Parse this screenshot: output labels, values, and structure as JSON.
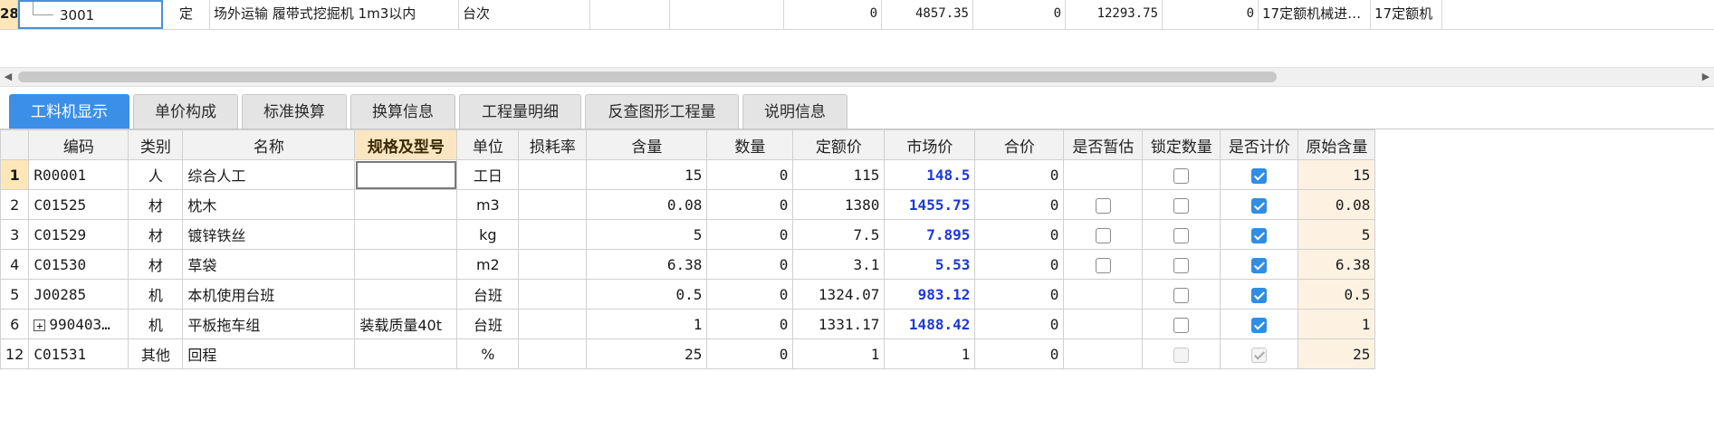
{
  "top_row": {
    "row_number": "28",
    "code": "3001",
    "type": "定",
    "name": "场外运输 履带式挖掘机 1m3以内",
    "unit": "台次",
    "c1": "0",
    "c2": "4857.35",
    "c3": "0",
    "c4": "12293.75",
    "c5": "0",
    "c6": "17定额机械进…",
    "c7": "17定额机"
  },
  "scrollbar": {
    "left_arrow": "◀",
    "right_arrow": "▶"
  },
  "tabs": [
    {
      "label": "工料机显示",
      "active": true
    },
    {
      "label": "单价构成"
    },
    {
      "label": "标准换算"
    },
    {
      "label": "换算信息"
    },
    {
      "label": "工程量明细"
    },
    {
      "label": "反查图形工程量"
    },
    {
      "label": "说明信息"
    }
  ],
  "columns": [
    "编码",
    "类别",
    "名称",
    "规格及型号",
    "单位",
    "损耗率",
    "含量",
    "数量",
    "定额价",
    "市场价",
    "合价",
    "是否暂估",
    "锁定数量",
    "是否计价",
    "原始含量"
  ],
  "rows": [
    {
      "rn": "1",
      "code": "R00001",
      "cat": "人",
      "name": "综合人工",
      "spec": "",
      "unit": "工日",
      "loss": "",
      "qty": "15",
      "num": "0",
      "price": "115",
      "market": "148.5",
      "total": "0",
      "est": null,
      "lock": false,
      "priced": true,
      "orig": "15"
    },
    {
      "rn": "2",
      "code": "C01525",
      "cat": "材",
      "name": "枕木",
      "spec": "",
      "unit": "m3",
      "loss": "",
      "qty": "0.08",
      "num": "0",
      "price": "1380",
      "market": "1455.75",
      "total": "0",
      "est": false,
      "lock": false,
      "priced": true,
      "orig": "0.08"
    },
    {
      "rn": "3",
      "code": "C01529",
      "cat": "材",
      "name": "镀锌铁丝",
      "spec": "",
      "unit": "kg",
      "loss": "",
      "qty": "5",
      "num": "0",
      "price": "7.5",
      "market": "7.895",
      "total": "0",
      "est": false,
      "lock": false,
      "priced": true,
      "orig": "5"
    },
    {
      "rn": "4",
      "code": "C01530",
      "cat": "材",
      "name": "草袋",
      "spec": "",
      "unit": "m2",
      "loss": "",
      "qty": "6.38",
      "num": "0",
      "price": "3.1",
      "market": "5.53",
      "total": "0",
      "est": false,
      "lock": false,
      "priced": true,
      "orig": "6.38"
    },
    {
      "rn": "5",
      "code": "J00285",
      "cat": "机",
      "name": "本机使用台班",
      "spec": "",
      "unit": "台班",
      "loss": "",
      "qty": "0.5",
      "num": "0",
      "price": "1324.07",
      "market": "983.12",
      "total": "0",
      "est": null,
      "lock": false,
      "priced": true,
      "orig": "0.5"
    },
    {
      "rn": "6",
      "code": "990403…",
      "cat": "机",
      "name": "平板拖车组",
      "spec": "装载质量40t",
      "unit": "台班",
      "loss": "",
      "qty": "1",
      "num": "0",
      "price": "1331.17",
      "market": "1488.42",
      "total": "0",
      "est": null,
      "lock": false,
      "priced": true,
      "orig": "1",
      "expander": "+"
    },
    {
      "rn": "12",
      "code": "C01531",
      "cat": "其他",
      "name": "回程",
      "spec": "",
      "unit": "%",
      "loss": "",
      "qty": "25",
      "num": "0",
      "price": "1",
      "market": "1",
      "total": "0",
      "est": null,
      "lock": false,
      "priced": true,
      "orig": "25",
      "disabled": true
    }
  ],
  "colors": {
    "tab_active": "#3c8fe6",
    "market_price": "#1c39d6",
    "checkbox_on": "#2f8de4",
    "header_highlight": "#fbe6c2"
  }
}
